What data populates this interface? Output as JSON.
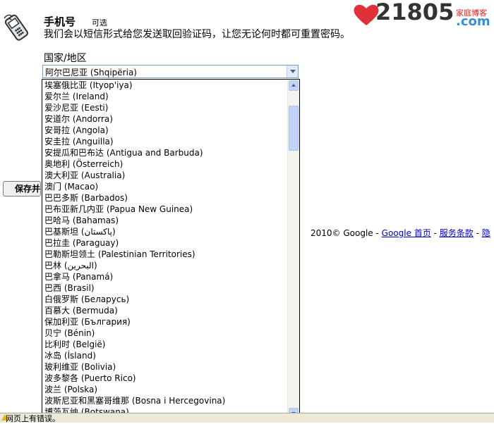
{
  "header": {
    "title": "手机号",
    "optional": "可选",
    "description": "我们会以短信形式给您发送取回验证码，让您无论何时都可重置密码。"
  },
  "country_label": "国家/地区",
  "country_select": {
    "selected": "阿尔巴尼亚 (Shqipëria)"
  },
  "country_options": [
    "埃塞俄比亚 (Ityop'iya)",
    "爱尔兰 (Ireland)",
    "爱沙尼亚 (Eesti)",
    "安道尔 (Andorra)",
    "安哥拉 (Angola)",
    "安圭拉 (Anguilla)",
    "安提瓜和巴布达 (Antigua and Barbuda)",
    "奥地利 (Österreich)",
    "澳大利亚 (Australia)",
    "澳门 (Macao)",
    "巴巴多斯 (Barbados)",
    "巴布亚新几内亚 (Papua New Guinea)",
    "巴哈马 (Bahamas)",
    "巴基斯坦 (پاکستان)",
    "巴拉圭 (Paraguay)",
    "巴勒斯坦领土 (Palestinian Territories)",
    "巴林 (البحرين)",
    "巴拿马 (Panamá)",
    "巴西 (Brasil)",
    "白俄罗斯 (Беларусь)",
    "百慕大 (Bermuda)",
    "保加利亚 (България)",
    "贝宁 (Bénin)",
    "比利时 (België)",
    "冰岛 (Ísland)",
    "玻利维亚 (Bolivia)",
    "波多黎各 (Puerto Rico)",
    "波兰 (Polska)",
    "波斯尼亚和黑塞哥维那 (Bosna i Hercegovina)",
    "博茨瓦纳 (Botswana)"
  ],
  "save_button_label": "保存并",
  "footer": {
    "copyright": "2010© Google - ",
    "link_home": "Google 首页",
    "sep1": " - ",
    "link_terms": "服务条款",
    "sep2": " - ",
    "link_privacy": "隐"
  },
  "status_bar": {
    "text": "网页上有错误。"
  },
  "watermark": {
    "number": "21805",
    "cn_text": "家庭博客",
    "domain": ".com"
  },
  "colors": {
    "link": "#0000cc",
    "watermark_red": "#e02020",
    "watermark_blue": "#3a8fd0"
  },
  "icons": {
    "phone": "phone-icon",
    "dropdown_arrow": "chevron-down-icon",
    "warning": "warning-icon"
  }
}
